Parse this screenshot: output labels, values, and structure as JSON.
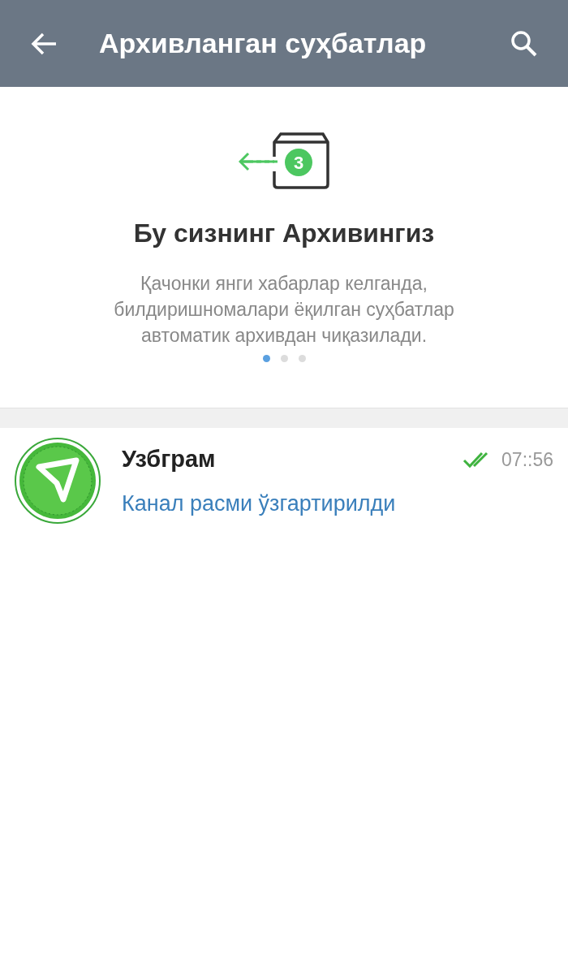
{
  "header": {
    "title": "Архивланган суҳбатлар"
  },
  "intro": {
    "badge": "3",
    "title": "Бу сизнинг Архивингиз",
    "text": "Қачонки янги хабарлар келганда, билдиришномалари ёқилган суҳбатлар автоматик архивдан чиқазилади.",
    "pages": [
      {
        "selected": true
      },
      {
        "selected": false
      },
      {
        "selected": false
      }
    ]
  },
  "chats": [
    {
      "name": "Узбграм",
      "message": "Канал расми ўзгартирилди",
      "time": "07::56",
      "read": true
    }
  ]
}
